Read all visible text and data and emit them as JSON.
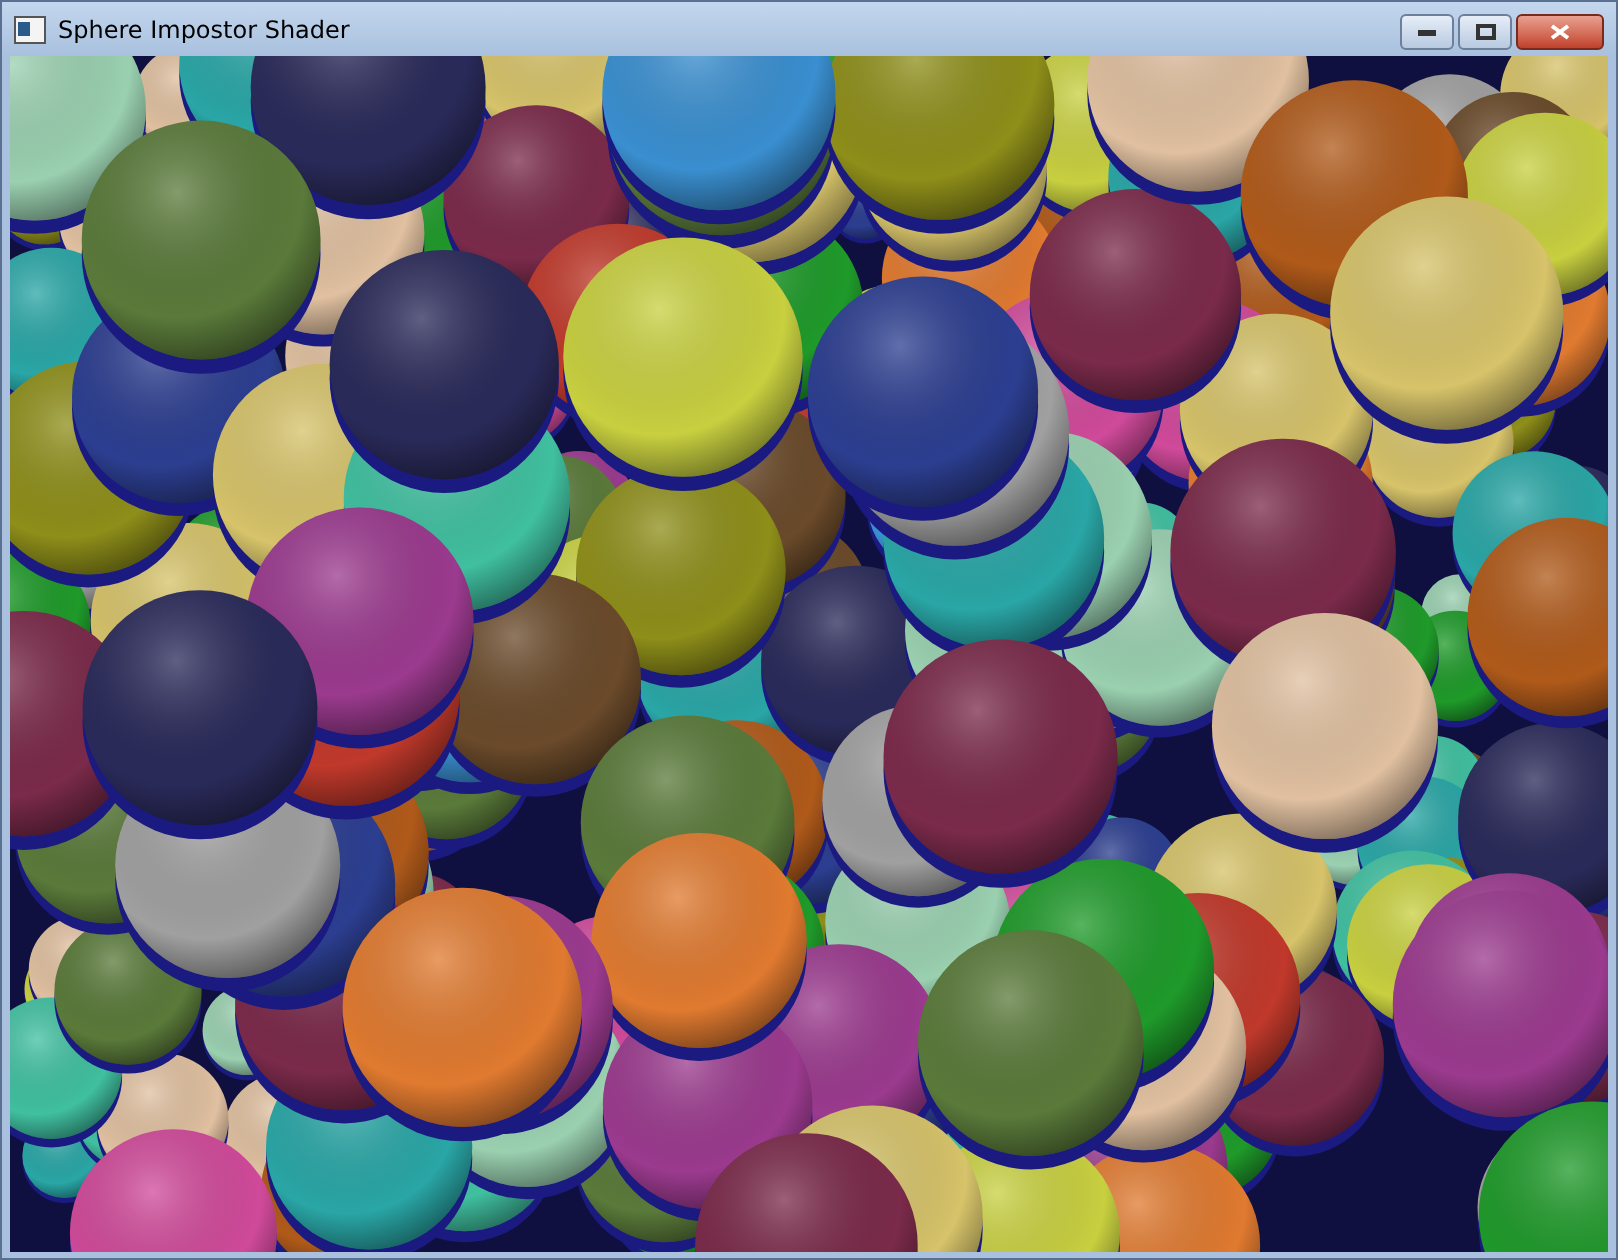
{
  "window": {
    "title": "Sphere Impostor Shader"
  }
}
